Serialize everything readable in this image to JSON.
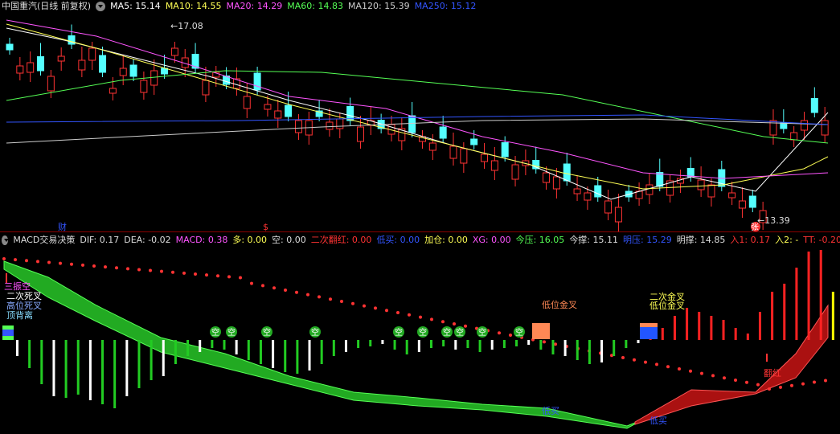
{
  "main_legend": {
    "title": "中国重汽(日线 前复权)",
    "ma": [
      {
        "label": "MA5: 15.14",
        "color": "#ffffff"
      },
      {
        "label": "MA10: 14.55",
        "color": "#ffff55"
      },
      {
        "label": "MA20: 14.29",
        "color": "#ff55ff"
      },
      {
        "label": "MA60: 14.83",
        "color": "#55ff55"
      },
      {
        "label": "MA120: 15.39",
        "color": "#cccccc"
      },
      {
        "label": "MA250: 15.12",
        "color": "#3355ff"
      }
    ]
  },
  "price_labels": {
    "high": "17.08",
    "low": "13.39",
    "cai": "财",
    "dollar": "$",
    "zhang": "张"
  },
  "macd_legend": {
    "title": "MACD交易决策",
    "items": [
      {
        "label": "DIF: 0.17",
        "color": "#dddddd"
      },
      {
        "label": "DEA: -0.02",
        "color": "#dddddd"
      },
      {
        "label": "MACD: 0.38",
        "color": "#ff55ff"
      },
      {
        "label": "多: 0.00",
        "color": "#ffff55"
      },
      {
        "label": "空: 0.00",
        "color": "#dddddd"
      },
      {
        "label": "二次翻红: 0.00",
        "color": "#ff3333"
      },
      {
        "label": "低买: 0.00",
        "color": "#3355ff"
      },
      {
        "label": "加仓: 0.00",
        "color": "#ffff55"
      },
      {
        "label": "XG: 0.00",
        "color": "#ff55ff"
      },
      {
        "label": "今压: 16.05",
        "color": "#55ff55"
      },
      {
        "label": "今撑: 15.11",
        "color": "#dddddd"
      },
      {
        "label": "明压: 15.29",
        "color": "#3355ff"
      },
      {
        "label": "明撑: 14.85",
        "color": "#dddddd"
      },
      {
        "label": "入1: 0.17",
        "color": "#ff3333"
      },
      {
        "label": "入2: -",
        "color": "#ffff55"
      },
      {
        "label": "TT: -0.20",
        "color": "#ff3333"
      }
    ]
  },
  "signals": {
    "sanduo": "三振空",
    "erci_sicha": "二次死叉",
    "gaowei_sicha": "高位死叉",
    "ding_beili": "顶背离",
    "diwei_jincha": "低位金叉",
    "erci_jincha": "二次金叉",
    "diwei_jincha2": "低位金叉",
    "kong": "空",
    "dimai1": "低买",
    "dimai2": "低买",
    "fanhong": "翻红"
  },
  "colors": {
    "up": "#ff3333",
    "down": "#54ffff",
    "bg": "#000000"
  }
}
